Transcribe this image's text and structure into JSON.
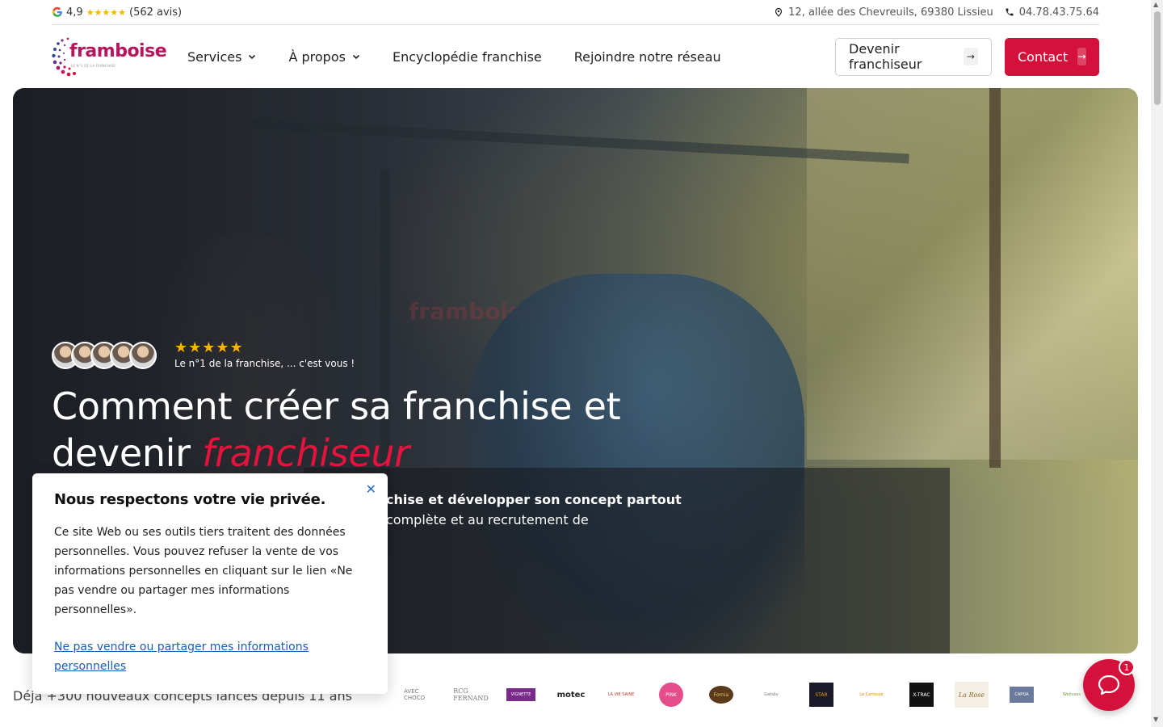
{
  "topbar": {
    "rating": "4,9",
    "stars": "★★★★★",
    "reviews": "(562 avis)",
    "address": "12, allée des Chevreuils, 69380 Lissieu",
    "phone": "04.78.43.75.64"
  },
  "header": {
    "logo_text": "framboise",
    "logo_sub": "LE N°1 DE LA FRANCHISE",
    "nav": [
      {
        "label": "Services",
        "dropdown": true
      },
      {
        "label": "À propos",
        "dropdown": true
      },
      {
        "label": "Encyclopédie franchise",
        "dropdown": false
      },
      {
        "label": "Rejoindre notre réseau",
        "dropdown": false
      }
    ],
    "btn_franchiseur": "Devenir franchiseur",
    "btn_contact": "Contact"
  },
  "hero": {
    "stars": "★★★★★",
    "badge_caption": "Le n°1 de la franchise, ... c'est vous !",
    "title_line1": "Comment créer sa franchise et",
    "title_line2_plain": "devenir ",
    "title_line2_accent": "franchiseur",
    "sub_bold": "chise et développer son concept partout",
    "sub_regular": "complète et au recrutement de",
    "watermark": "framboise"
  },
  "bottom": {
    "tagline": "Déjà +300 nouveaux concepts lancés depuis 11 ans",
    "brands": [
      "AVEC CHOCO",
      "RCG FERNAND",
      "VIGNETTE",
      "motec",
      "LA VIE SAINE",
      "PINK",
      "Fornia",
      "Gatsby",
      "STAR",
      "Le Carrosse",
      "X-TRAC",
      "La Rose",
      "CAPOA",
      "Wellness"
    ]
  },
  "privacy": {
    "title": "Nous respectons votre vie privée.",
    "body": "Ce site Web ou ses outils tiers traitent des données personnelles. Vous pouvez refuser la vente de vos informations personnelles en cliquant sur le lien «Ne pas vendre ou partager mes informations personnelles».",
    "link": "Ne pas vendre ou partager mes informations personnelles",
    "close": "✕"
  },
  "chat": {
    "badge": "1"
  },
  "colors": {
    "brand": "#d4113a",
    "accent": "#e8123d",
    "star": "#f5b400"
  }
}
